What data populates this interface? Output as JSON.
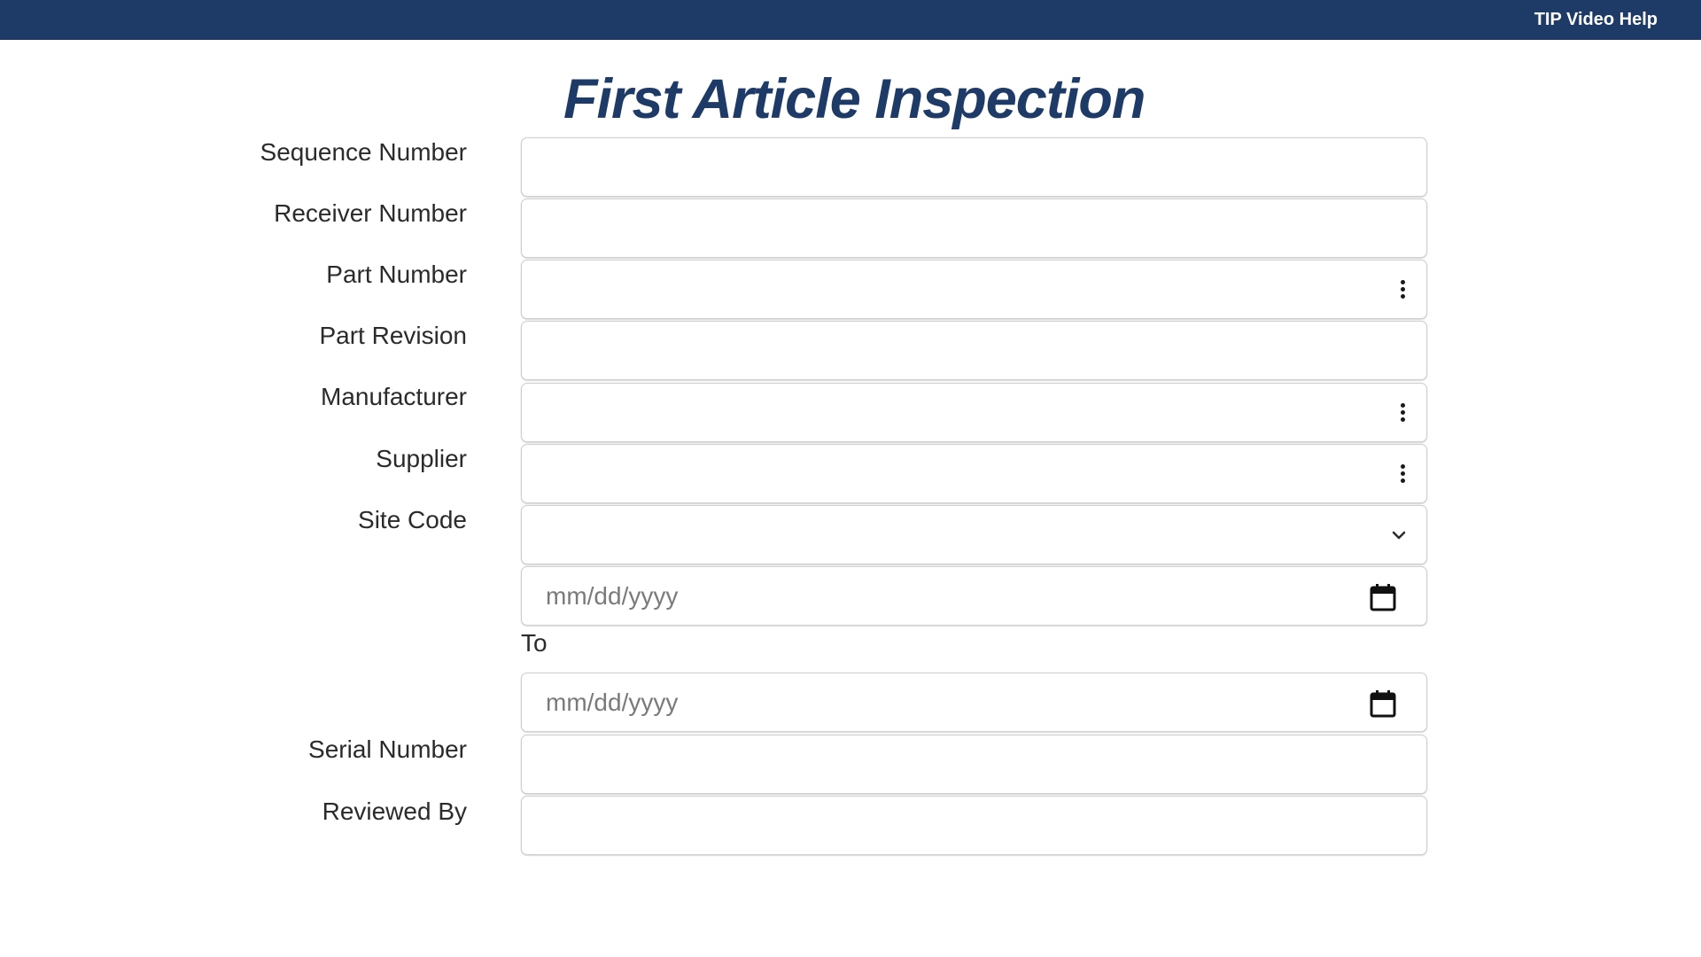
{
  "header": {
    "help_link": "TIP Video Help"
  },
  "page": {
    "title": "First Article Inspection"
  },
  "form": {
    "sequence_number": {
      "label": "Sequence Number",
      "value": ""
    },
    "receiver_number": {
      "label": "Receiver Number",
      "value": ""
    },
    "part_number": {
      "label": "Part Number",
      "value": "",
      "icon": "kebab-icon"
    },
    "part_revision": {
      "label": "Part Revision",
      "value": ""
    },
    "manufacturer": {
      "label": "Manufacturer",
      "value": "",
      "icon": "kebab-icon"
    },
    "supplier": {
      "label": "Supplier",
      "value": "",
      "icon": "kebab-icon"
    },
    "site_code": {
      "label": "Site Code",
      "selected": "",
      "icon": "chevron-down-icon"
    },
    "date_from": {
      "placeholder": "mm/dd/yyyy",
      "icon": "calendar-icon"
    },
    "to_label": "To",
    "date_to": {
      "placeholder": "mm/dd/yyyy",
      "icon": "calendar-icon"
    },
    "serial_number": {
      "label": "Serial Number",
      "value": ""
    },
    "reviewed_by": {
      "label": "Reviewed By",
      "value": ""
    }
  },
  "colors": {
    "header_bg": "#1e3a66",
    "title": "#1e3a66",
    "label_text": "#2b2b2b",
    "field_border": "#cfcfcf",
    "placeholder": "#7a7a7a"
  }
}
